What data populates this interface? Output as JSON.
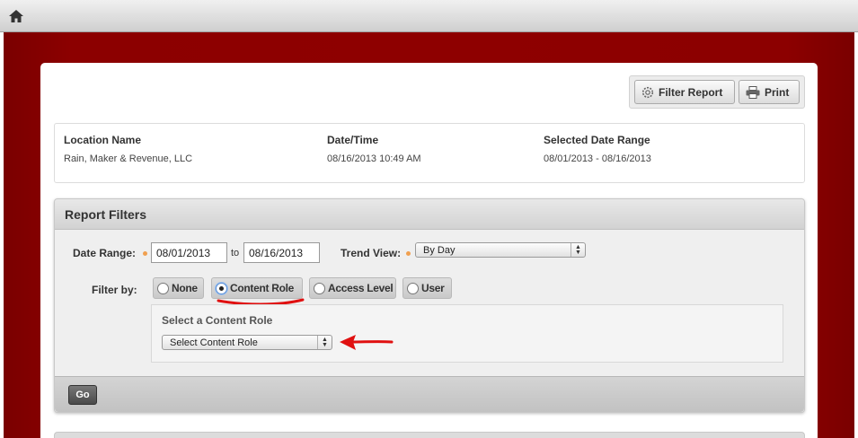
{
  "topbar": {
    "home_icon": "home-icon"
  },
  "toolbar": {
    "filter_report_label": "Filter Report",
    "print_label": "Print"
  },
  "info": {
    "location_label": "Location Name",
    "location_value": "Rain, Maker & Revenue, LLC",
    "datetime_label": "Date/Time",
    "datetime_value": "08/16/2013 10:49 AM",
    "range_label": "Selected Date Range",
    "range_value": "08/01/2013 - 08/16/2013"
  },
  "filters": {
    "title": "Report Filters",
    "date_range_label": "Date Range:",
    "date_from": "08/01/2013",
    "to_label": "to",
    "date_to": "08/16/2013",
    "trend_view_label": "Trend View:",
    "trend_view_value": "By Day",
    "filter_by_label": "Filter by:",
    "options": [
      {
        "label": "None",
        "selected": false
      },
      {
        "label": "Content Role",
        "selected": true
      },
      {
        "label": "Access Level",
        "selected": false
      },
      {
        "label": "User",
        "selected": false
      }
    ],
    "role_heading": "Select a Content Role",
    "role_select_value": "Select Content Role",
    "go_label": "Go"
  },
  "annotation_colors": {
    "underline": "#e01010",
    "arrow": "#e01010"
  }
}
